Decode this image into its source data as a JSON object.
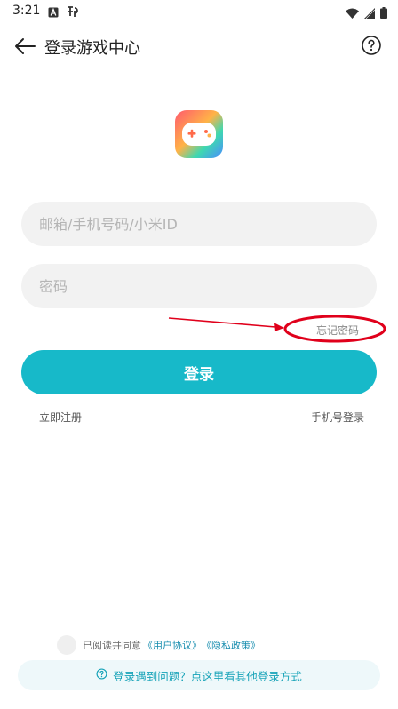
{
  "status_bar": {
    "time": "3:21",
    "left_icons": [
      "notification-a-icon",
      "app-notification-icon"
    ],
    "right_icons": [
      "wifi-icon",
      "signal-icon",
      "battery-icon"
    ]
  },
  "header": {
    "title": "登录游戏中心",
    "back_icon": "arrow-left-icon",
    "help_icon": "question-circle-icon"
  },
  "logo": {
    "icon": "gamepad-icon",
    "colors": [
      "#ff5a6e",
      "#ffb347",
      "#3ed8b0",
      "#4a8cff"
    ]
  },
  "form": {
    "account_placeholder": "邮箱/手机号码/小米ID",
    "account_value": "",
    "password_placeholder": "密码",
    "password_value": "",
    "forgot_password": "忘记密码",
    "login_label": "登录",
    "register_label": "立即注册",
    "phone_login_label": "手机号登录"
  },
  "agreement": {
    "prefix": "已阅读并同意",
    "user_agreement": "《用户协议》",
    "privacy_policy": "《隐私政策》",
    "checked": false
  },
  "help_banner": {
    "icon": "question-circle-icon",
    "text": "登录遇到问题？点这里看其他登录方式"
  },
  "colors": {
    "accent": "#17b9c9",
    "annotation": "#e0001b",
    "link": "#1b8fb0"
  }
}
